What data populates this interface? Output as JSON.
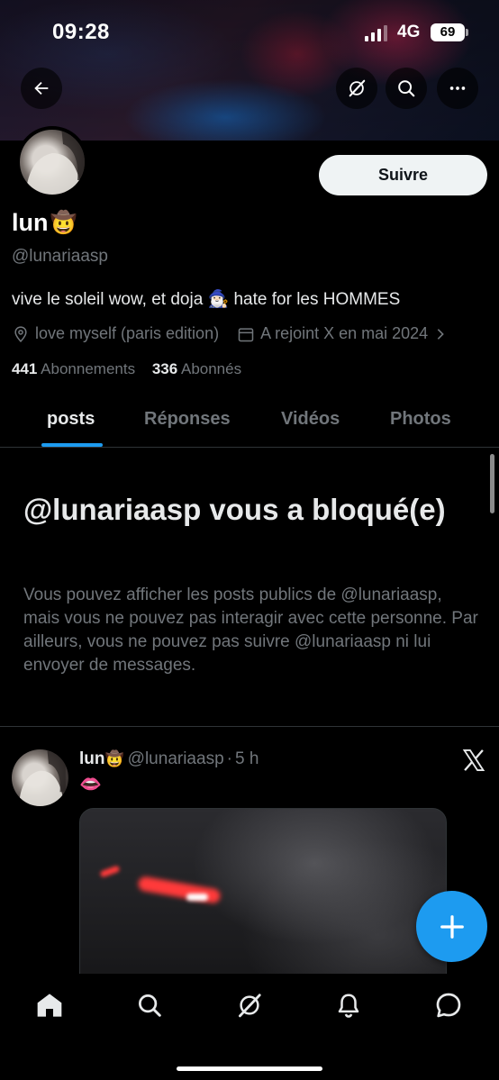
{
  "status_bar": {
    "time": "09:28",
    "network": "4G",
    "battery": "69"
  },
  "top_bar": {
    "back_icon": "arrow-left-icon",
    "grok_icon": "grok-icon",
    "search_icon": "search-icon",
    "more_icon": "more-horizontal-icon"
  },
  "profile": {
    "name": "lun",
    "name_emoji": "🤠",
    "handle": "@lunariaasp",
    "follow_label": "Suivre",
    "bio": "vive le soleil wow, et doja 🧙🏻‍♂️ hate for les HOMMES",
    "location": "love myself (paris edition)",
    "joined": "A rejoint X en mai 2024",
    "following_count": "441",
    "following_label": "Abonnements",
    "followers_count": "336",
    "followers_label": "Abonnés"
  },
  "tabs": [
    {
      "label": "posts",
      "active": true
    },
    {
      "label": "Réponses",
      "active": false
    },
    {
      "label": "Vidéos",
      "active": false
    },
    {
      "label": "Photos",
      "active": false
    }
  ],
  "blocked": {
    "title": "@lunariaasp vous a bloqué(e)",
    "description": "Vous pouvez afficher les posts publics de @lunariaasp, mais vous ne pouvez pas interagir avec cette personne. Par ailleurs, vous ne pouvez pas suivre @lunariaasp ni lui envoyer de messages."
  },
  "post": {
    "name": "lun",
    "name_emoji": "🤠",
    "handle": "@lunariaasp",
    "separator": "·",
    "time": "5 h",
    "text": "👄"
  },
  "bottom_nav": [
    "home-icon",
    "search-icon",
    "grok-icon",
    "bell-icon",
    "messages-icon"
  ],
  "colors": {
    "accent": "#1d9bf0",
    "text_primary": "#e7e9ea",
    "text_secondary": "#71767b",
    "border": "#2f3336",
    "background": "#000000"
  }
}
